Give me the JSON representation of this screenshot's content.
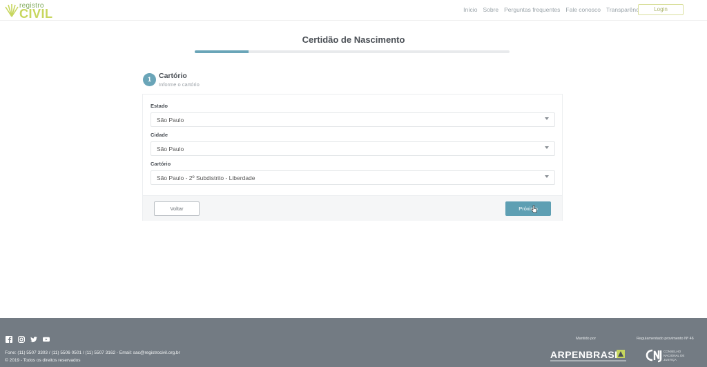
{
  "header": {
    "logo_small": "registro",
    "logo_big": "CIVIL",
    "nav": [
      "Início",
      "Sobre",
      "Perguntas frequentes",
      "Fale conosco",
      "Transparência"
    ],
    "login_label": "Login"
  },
  "page": {
    "title": "Certidão de Nascimento",
    "progress_percent": 17
  },
  "step": {
    "number": "1",
    "title": "Cartório",
    "subtitle": "Informe o cartório"
  },
  "form": {
    "estado_label": "Estado",
    "estado_value": "São Paulo",
    "cidade_label": "Cidade",
    "cidade_value": "São Paulo",
    "cartorio_label": "Cartório",
    "cartorio_value": "São Paulo - 2º Subdistrito - Liberdade"
  },
  "actions": {
    "back_label": "Voltar",
    "next_label": "Próximo"
  },
  "footer": {
    "social_icons": [
      "facebook-icon",
      "instagram-icon",
      "twitter-icon",
      "youtube-icon"
    ],
    "contact": "Fone: (11) 5507 3303 / (11) 5506 0501 / (11) 5507 3162 - Email: sac@registrocivil.org.br",
    "copyright": "© 2019 - Todos os direitos reservados",
    "maintained_by": "Mantido por",
    "regulated_by": "Regulamentado provimento Nº 46",
    "arpen": "ARPENBRASIL",
    "cnj": "CNJ",
    "cnj_text": "CONSELHO NACIONAL DE JUSTIÇA"
  },
  "colors": {
    "accent": "#5e9fb3",
    "footer_bg": "#737b83",
    "logo_green": "#c7d65e"
  }
}
